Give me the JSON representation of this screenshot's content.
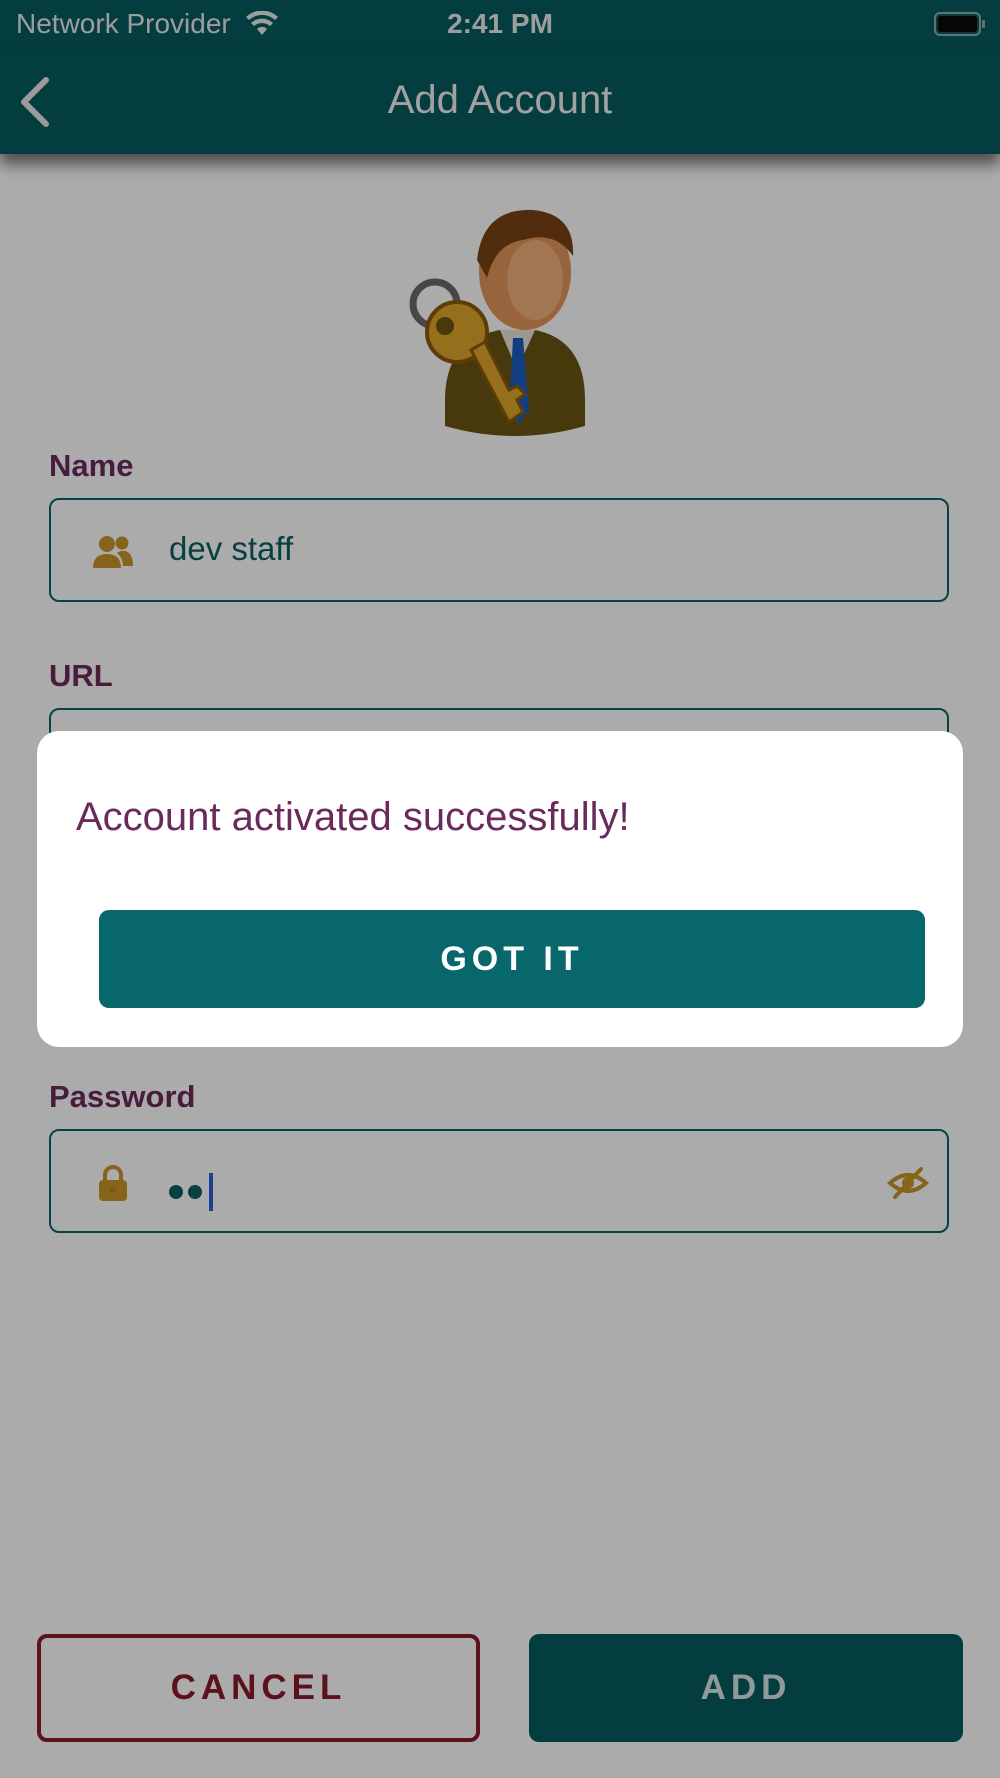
{
  "status_bar": {
    "carrier": "Network Provider",
    "time": "2:41 PM",
    "wifi_icon": "wifi-icon",
    "battery_icon": "battery-full-icon"
  },
  "nav": {
    "title": "Add Account",
    "back_icon": "chevron-left-icon"
  },
  "hero": {
    "icon": "user-with-key-illustration"
  },
  "form": {
    "name": {
      "label": "Name",
      "value": "dev staff",
      "icon": "people-icon"
    },
    "url": {
      "label": "URL"
    },
    "password": {
      "label": "Password",
      "masked_length": 2,
      "lead_icon": "lock-icon",
      "trail_icon": "eye-off-icon"
    }
  },
  "footer": {
    "cancel_label": "CANCEL",
    "add_label": "ADD"
  },
  "dialog": {
    "message": "Account activated successfully!",
    "confirm_label": "GOT IT"
  },
  "colors": {
    "header": "#075c5f",
    "accent_teal": "#08676a",
    "label_purple": "#6a2a5c",
    "icon_gold": "#c9952a",
    "cancel_red": "#8a1b2b"
  }
}
